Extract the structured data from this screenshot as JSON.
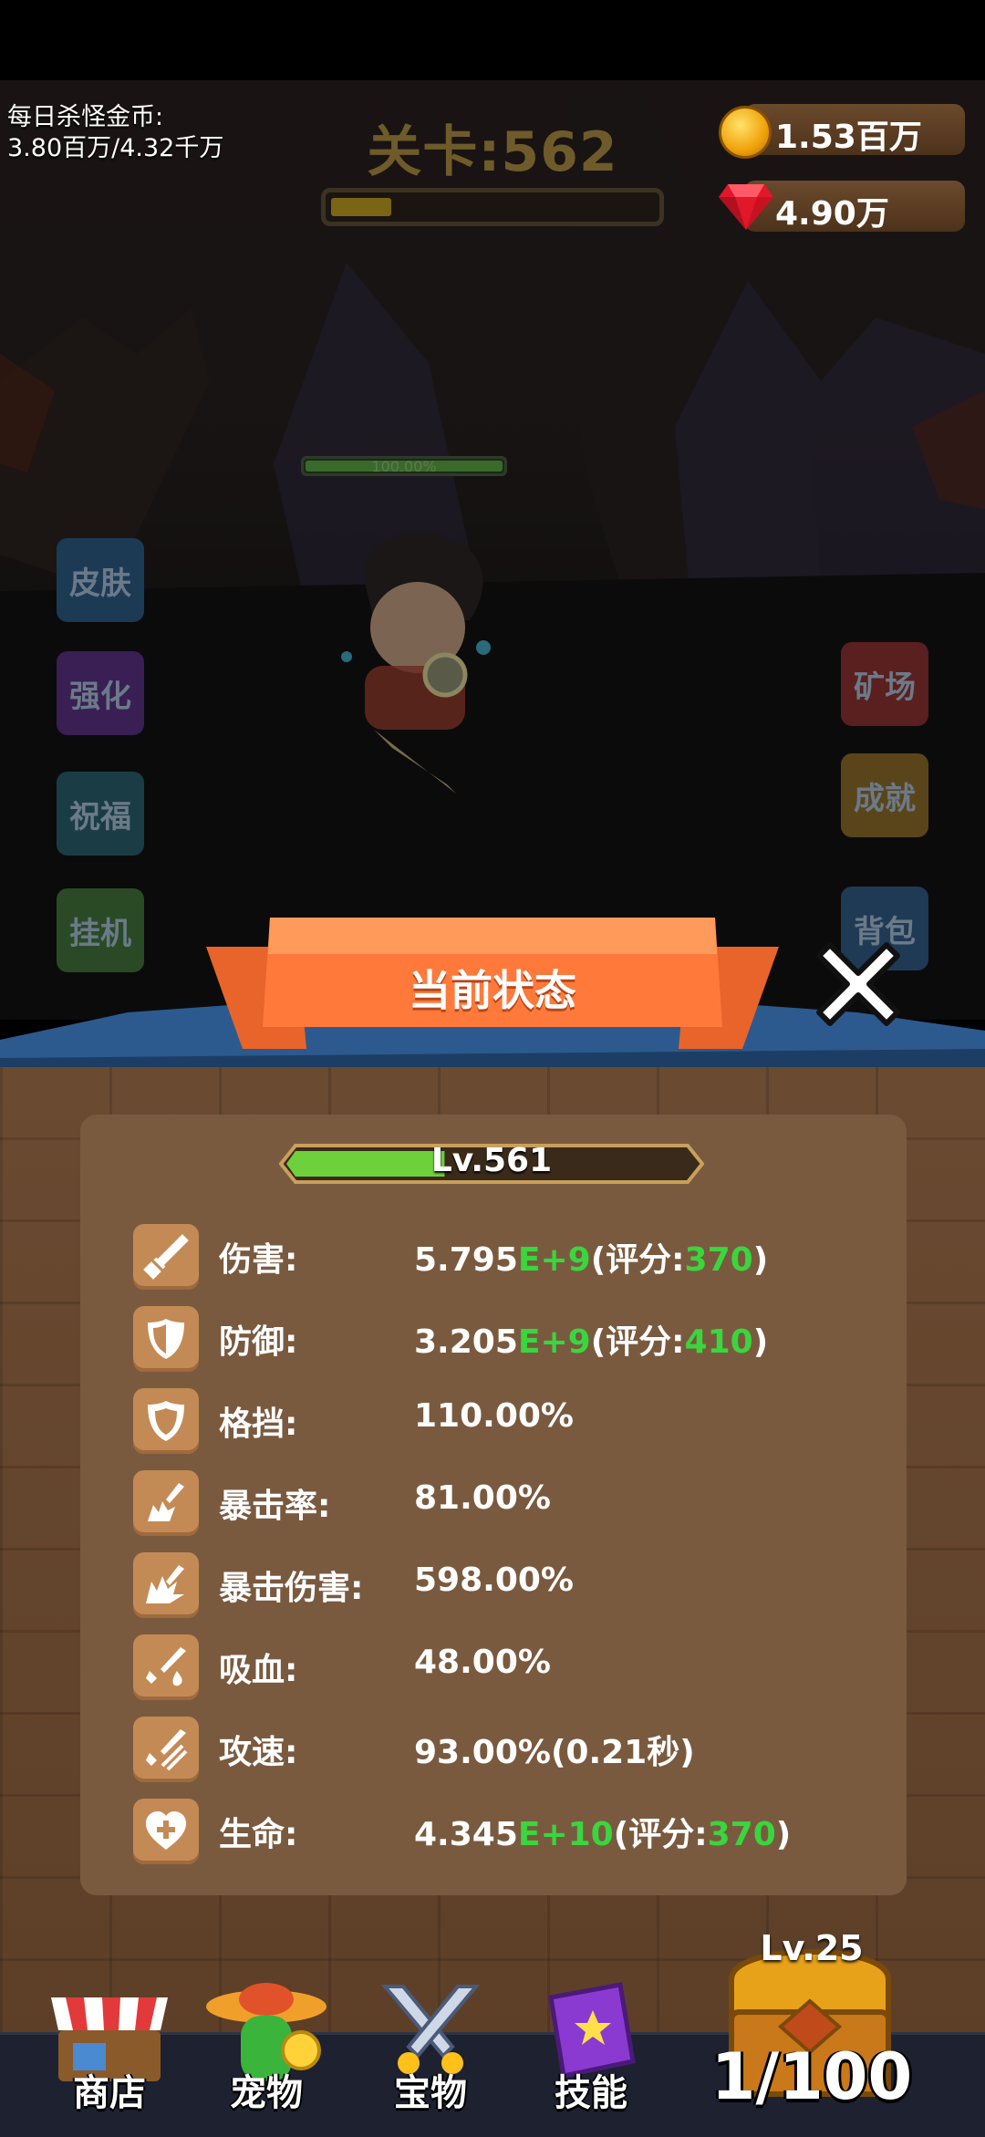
{
  "hud": {
    "daily_label": "每日杀怪金币:",
    "daily_value": "3.80百万/4.32千万",
    "stage": "关卡:562",
    "stage_progress": 0.18,
    "gold": "1.53百万",
    "gems": "4.90万"
  },
  "scene": {
    "hp_text": "100.00%",
    "left_buttons": [
      "皮肤",
      "强化",
      "祝福",
      "挂机"
    ],
    "right_buttons": [
      "矿场",
      "成就",
      "背包"
    ]
  },
  "dialog": {
    "title": "当前状态",
    "level": "Lv.561",
    "level_progress": 0.38,
    "stats": [
      {
        "label": "伤害:",
        "icon": "sword-icon",
        "base": "5.795",
        "exp": "E+9",
        "score_prefix": "(评分:",
        "score": "370",
        "score_suffix": ")"
      },
      {
        "label": "防御:",
        "icon": "shield-icon",
        "base": "3.205",
        "exp": "E+9",
        "score_prefix": "(评分:",
        "score": "410",
        "score_suffix": ")"
      },
      {
        "label": "格挡:",
        "icon": "block-shield-icon",
        "value": "110.00%"
      },
      {
        "label": "暴击率:",
        "icon": "crit-burst-icon",
        "value": "81.00%"
      },
      {
        "label": "暴击伤害:",
        "icon": "crit-damage-icon",
        "value": "598.00%"
      },
      {
        "label": "吸血:",
        "icon": "lifesteal-icon",
        "value": "48.00%"
      },
      {
        "label": "攻速:",
        "icon": "attack-speed-icon",
        "value": "93.00%(0.21秒)"
      },
      {
        "label": "生命:",
        "icon": "heart-plus-icon",
        "base": "4.345",
        "exp": "E+10",
        "score_prefix": "(评分:",
        "score": "370",
        "score_suffix": ")"
      }
    ]
  },
  "nav": {
    "items": [
      {
        "label": "商店",
        "icon": "shop-icon"
      },
      {
        "label": "宠物",
        "icon": "pet-icon"
      },
      {
        "label": "宝物",
        "icon": "treasure-swords-icon"
      },
      {
        "label": "技能",
        "icon": "skill-book-icon"
      }
    ],
    "chest_level": "Lv.25",
    "chest_count": "1/100"
  },
  "colors": {
    "accent_green": "#39d63e",
    "ribbon": "#ff7a3a",
    "panel": "#6a4a31"
  }
}
